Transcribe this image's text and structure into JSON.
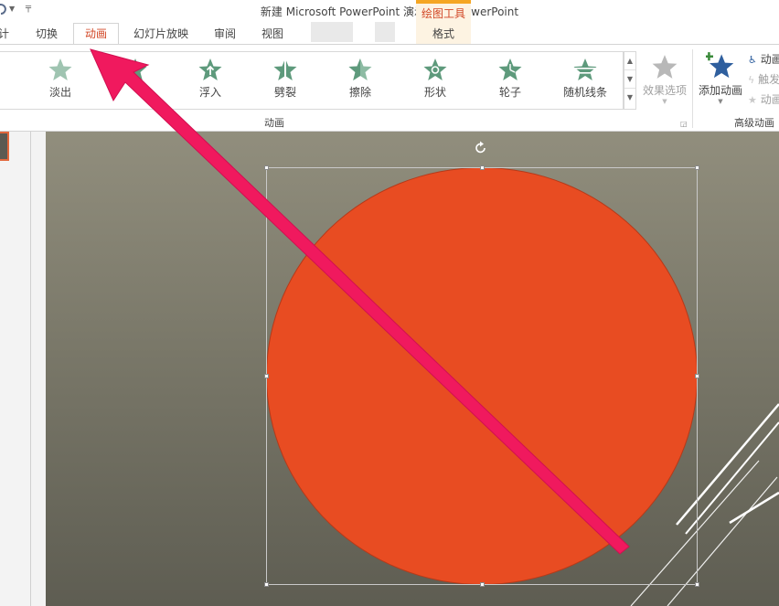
{
  "window": {
    "title": "新建 Microsoft PowerPoint 演示文稿 - PowerPoint",
    "context_group": "绘图工具"
  },
  "tabs": [
    {
      "label": "计"
    },
    {
      "label": "切换"
    },
    {
      "label": "动画"
    },
    {
      "label": "幻灯片放映"
    },
    {
      "label": "审阅"
    },
    {
      "label": "视图"
    },
    {
      "label": "格式"
    }
  ],
  "active_tab": "动画",
  "ribbon": {
    "animations": [
      {
        "label": "淡出",
        "icon": "star-fade-icon"
      },
      {
        "label": "",
        "icon": "star-icon"
      },
      {
        "label": "浮入",
        "icon": "star-float-icon"
      },
      {
        "label": "劈裂",
        "icon": "star-split-icon"
      },
      {
        "label": "擦除",
        "icon": "star-wipe-icon"
      },
      {
        "label": "形状",
        "icon": "star-shape-icon"
      },
      {
        "label": "轮子",
        "icon": "star-wheel-icon"
      },
      {
        "label": "随机线条",
        "icon": "star-random-bars-icon"
      }
    ],
    "effect_options": "效果选项",
    "group_animation": "动画",
    "add_animation": "添加动画",
    "group_advanced": "高级动画",
    "advanced_items": [
      {
        "label": "动画",
        "icon": "animation-pane-icon"
      },
      {
        "label": "触发",
        "icon": "trigger-icon"
      },
      {
        "label": "动画",
        "icon": "animation-painter-icon"
      }
    ]
  },
  "colors": {
    "accent": "#d24726",
    "circle_fill": "#e84c22",
    "arrow": "#f0195e",
    "star_green": "#5e9a7c",
    "context_tab": "#f5a623"
  }
}
